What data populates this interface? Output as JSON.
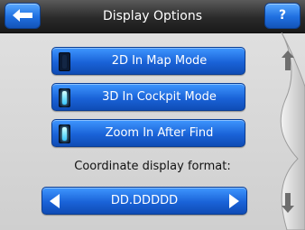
{
  "header": {
    "title": "Display Options",
    "help_label": "?"
  },
  "options": [
    {
      "label": "2D In Map Mode",
      "checked": false
    },
    {
      "label": "3D In Cockpit Mode",
      "checked": true
    },
    {
      "label": "Zoom In After Find",
      "checked": true
    }
  ],
  "coordinate": {
    "label": "Coordinate display format:",
    "value": "DD.DDDDD"
  },
  "icons": {
    "back": "arrow-left-icon",
    "scroll_up": "arrow-up-icon",
    "scroll_down": "arrow-down-icon",
    "prev": "triangle-left-icon",
    "next": "triangle-right-icon"
  },
  "colors": {
    "accent": "#1a63d8",
    "title_bar": "#2a2a2a",
    "led_on": "#7fe6ff"
  }
}
